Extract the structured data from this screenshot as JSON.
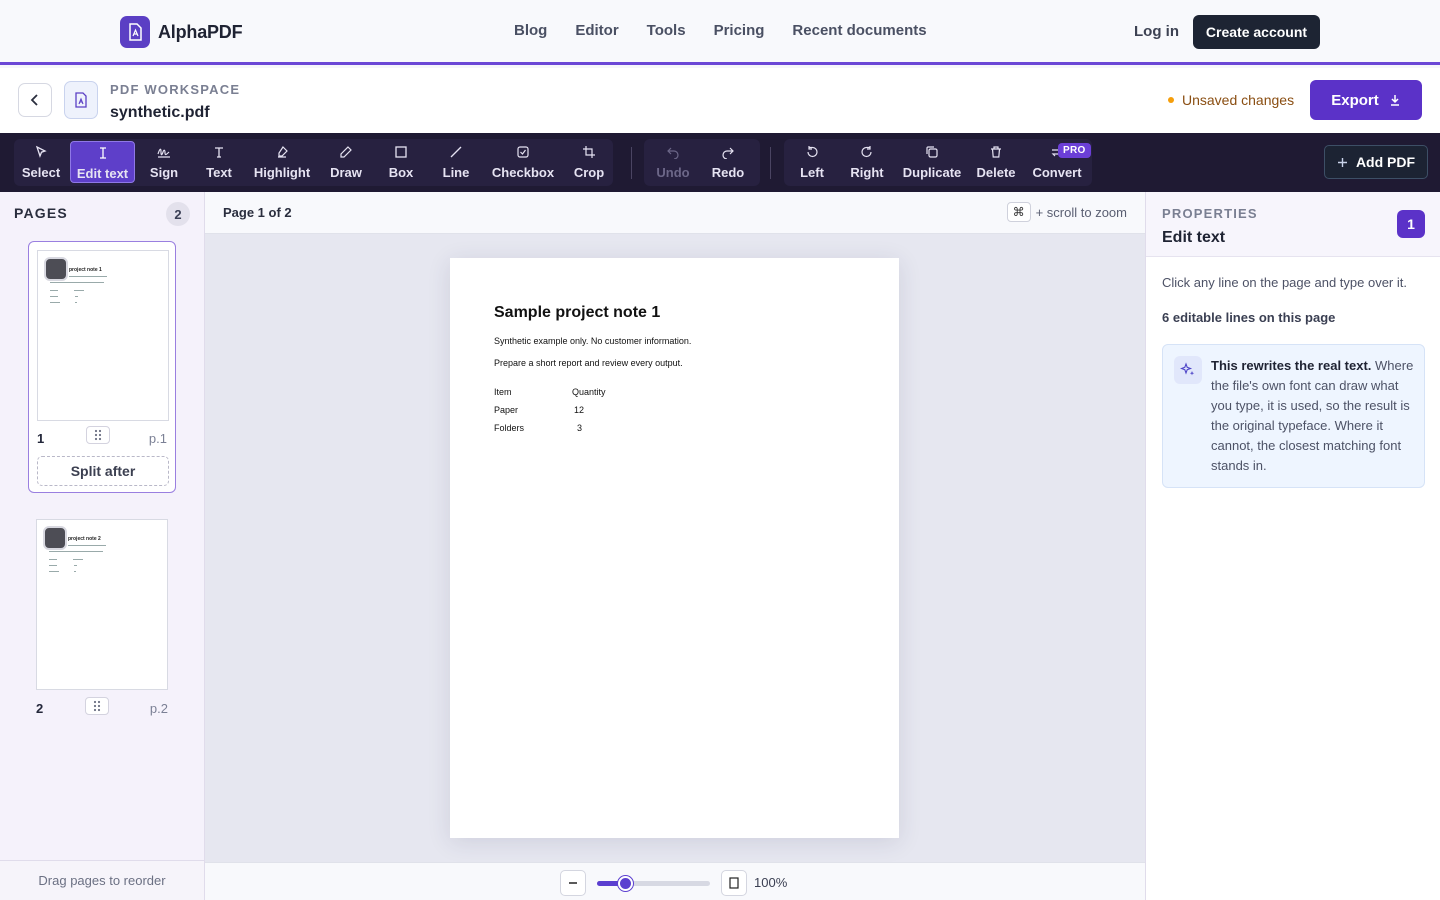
{
  "nav": {
    "brand": "AlphaPDF",
    "links": [
      "Blog",
      "Editor",
      "Tools",
      "Pricing",
      "Recent documents"
    ],
    "login": "Log in",
    "create_account": "Create account"
  },
  "workspace": {
    "label": "PDF WORKSPACE",
    "filename": "synthetic.pdf",
    "unsaved": "Unsaved changes",
    "export": "Export"
  },
  "toolbar": {
    "tools": [
      {
        "label": "Select",
        "icon": "cursor-icon"
      },
      {
        "label": "Edit text",
        "icon": "text-cursor-icon",
        "active": true
      },
      {
        "label": "Sign",
        "icon": "signature-icon"
      },
      {
        "label": "Text",
        "icon": "text-icon"
      },
      {
        "label": "Highlight",
        "icon": "highlighter-icon"
      },
      {
        "label": "Draw",
        "icon": "pencil-icon"
      },
      {
        "label": "Box",
        "icon": "square-icon"
      },
      {
        "label": "Line",
        "icon": "line-icon"
      },
      {
        "label": "Checkbox",
        "icon": "checkbox-icon"
      },
      {
        "label": "Crop",
        "icon": "crop-icon"
      },
      {
        "label": "Undo",
        "icon": "undo-icon",
        "disabled": true
      },
      {
        "label": "Redo",
        "icon": "redo-icon"
      },
      {
        "label": "Left",
        "icon": "rotate-left-icon"
      },
      {
        "label": "Right",
        "icon": "rotate-right-icon"
      },
      {
        "label": "Duplicate",
        "icon": "copy-icon"
      },
      {
        "label": "Delete",
        "icon": "trash-icon"
      },
      {
        "label": "Convert",
        "icon": "convert-icon"
      }
    ],
    "pro_badge": "PRO",
    "add_pdf": "Add PDF"
  },
  "pages_panel": {
    "title": "PAGES",
    "count": "2",
    "pages": [
      {
        "number": "1",
        "label": "p.1",
        "thumb_title": "project note 1"
      },
      {
        "number": "2",
        "label": "p.2",
        "thumb_title": "project note 2"
      }
    ],
    "split_after": "Split after",
    "footer": "Drag pages to reorder"
  },
  "canvas": {
    "page_info": "Page 1 of 2",
    "kbd": "⌘",
    "zoom_hint": "+ scroll to zoom",
    "zoom_value": "100%",
    "zoom_level": 0.25,
    "document": {
      "title": "Sample project note 1",
      "lines": [
        "Synthetic example only. No customer information.",
        "Prepare a short report and review every output."
      ],
      "table_headers": [
        "Item",
        "Quantity"
      ],
      "rows": [
        [
          "Paper",
          "12"
        ],
        [
          "Folders",
          "3"
        ]
      ]
    }
  },
  "properties": {
    "label": "PROPERTIES",
    "title": "Edit text",
    "badge": "1",
    "description": "Click any line on the page and type over it.",
    "editable_count": "6 editable lines on this page",
    "info_bold": "This rewrites the real text.",
    "info_body": "Where the file's own font can draw what you type, it is used, so the result is the original typeface. Where it cannot, the closest matching font stands in."
  },
  "colors": {
    "accent": "#5b32c8",
    "toolbar_bg": "#1f1a33",
    "unsaved_dot": "#f59e0b"
  }
}
